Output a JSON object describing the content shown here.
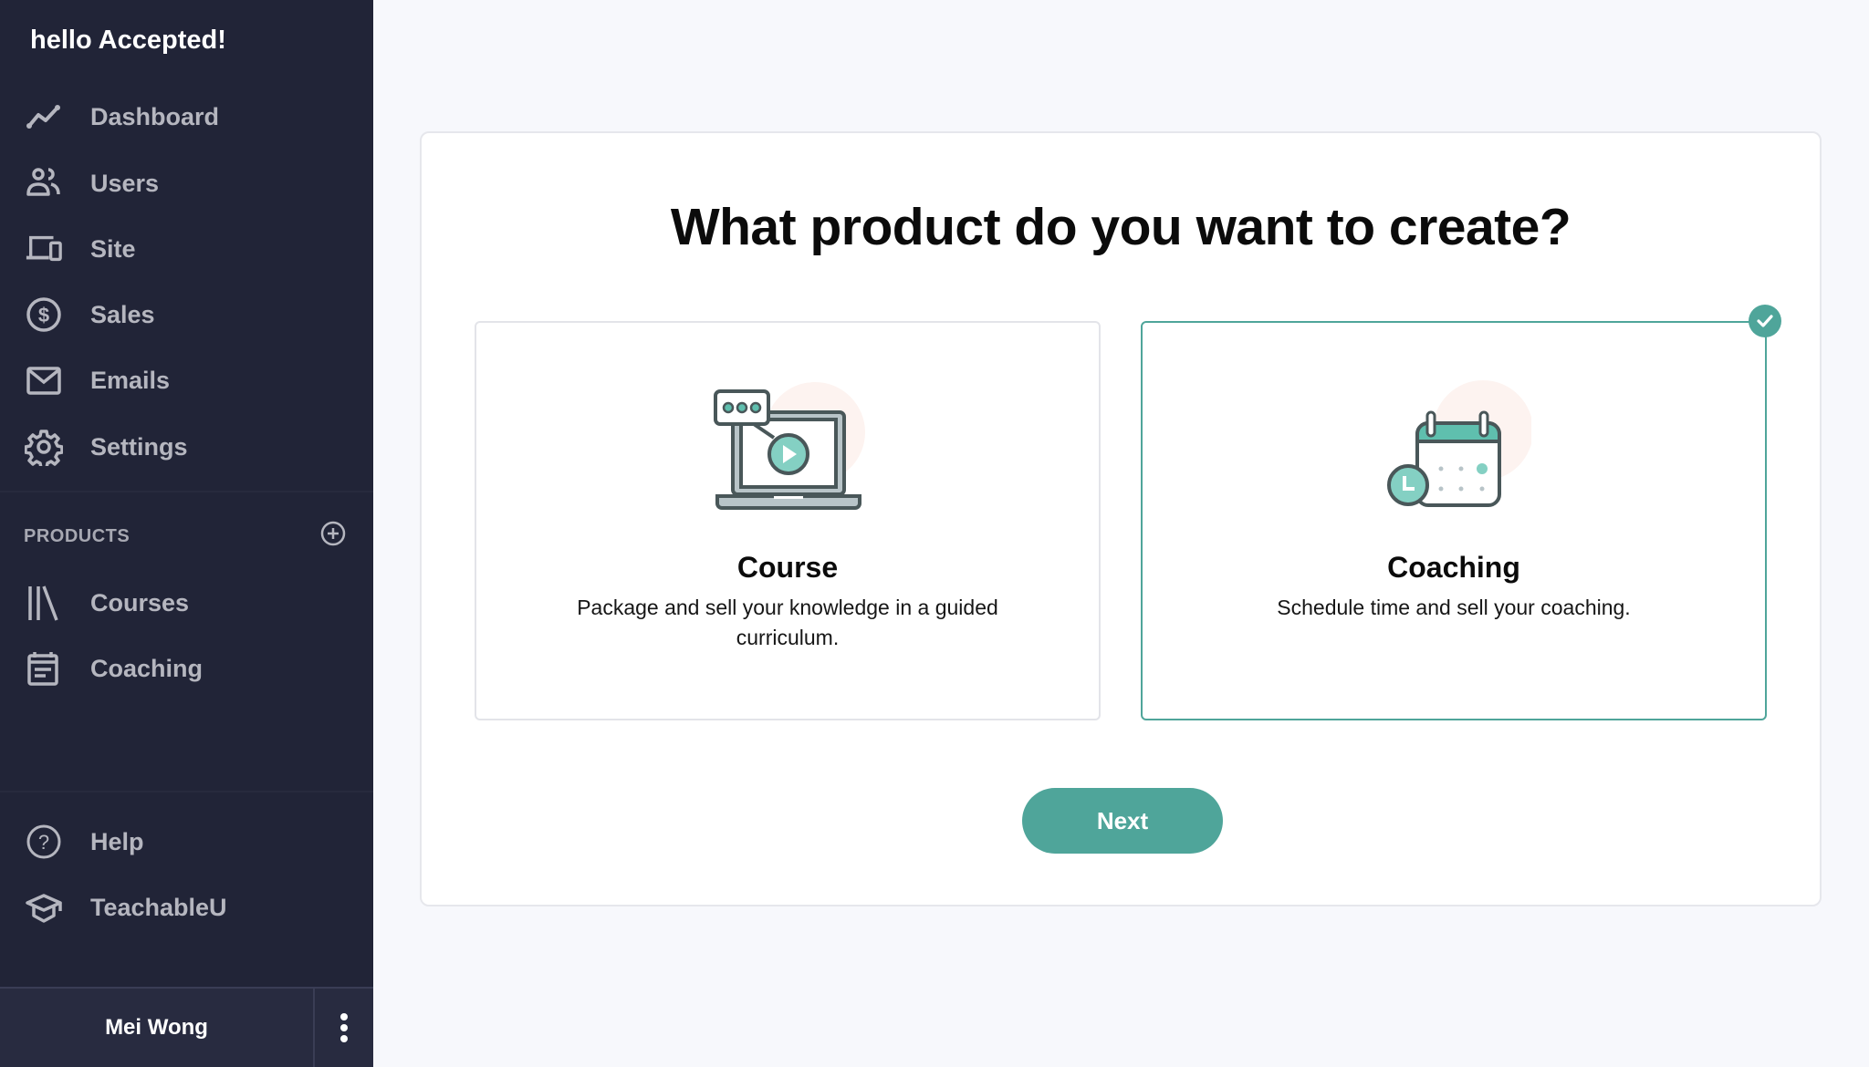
{
  "sidebar": {
    "greeting": "hello Accepted!",
    "main_items": [
      {
        "label": "Dashboard",
        "icon": "chart-line-icon"
      },
      {
        "label": "Users",
        "icon": "users-icon"
      },
      {
        "label": "Site",
        "icon": "devices-icon"
      },
      {
        "label": "Sales",
        "icon": "dollar-circle-icon"
      },
      {
        "label": "Emails",
        "icon": "envelope-icon"
      },
      {
        "label": "Settings",
        "icon": "gear-icon"
      }
    ],
    "products_section": {
      "label": "PRODUCTS",
      "add_icon": "plus-circle-icon",
      "items": [
        {
          "label": "Courses",
          "icon": "library-icon"
        },
        {
          "label": "Coaching",
          "icon": "calendar-icon"
        }
      ]
    },
    "bottom_items": [
      {
        "label": "Help",
        "icon": "question-circle-icon"
      },
      {
        "label": "TeachableU",
        "icon": "graduation-cap-icon"
      }
    ],
    "user": {
      "name": "Mei Wong",
      "menu_icon": "kebab-menu-icon"
    }
  },
  "main": {
    "title": "What product do you want to create?",
    "options": [
      {
        "title": "Course",
        "description": "Package and sell your knowledge in a guided curriculum.",
        "icon": "laptop-video-icon",
        "selected": false
      },
      {
        "title": "Coaching",
        "description": "Schedule time and sell your coaching.",
        "icon": "calendar-clock-icon",
        "selected": true
      }
    ],
    "next_label": "Next"
  },
  "colors": {
    "sidebar_bg": "#212437",
    "accent": "#4fa59a",
    "page_bg": "#f7f8fc"
  }
}
